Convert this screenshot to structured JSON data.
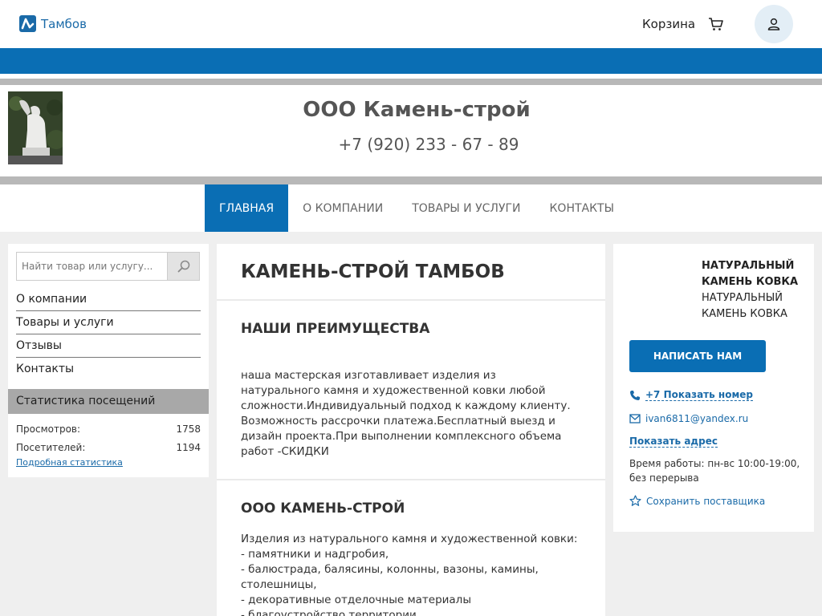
{
  "topbar": {
    "city": "Тамбов",
    "cart_label": "Корзина"
  },
  "header": {
    "company_name": "ООО Камень-строй",
    "phone": "+7 (920) 233 - 67 - 89"
  },
  "nav": {
    "items": [
      {
        "label": "Главная",
        "active": true
      },
      {
        "label": "О компании"
      },
      {
        "label": "Товары и услуги"
      },
      {
        "label": "Контакты"
      }
    ]
  },
  "sidebar": {
    "search_placeholder": "Найти товар или услугу...",
    "menu": [
      "О компании",
      "Товары и услуги",
      "Отзывы",
      "Контакты"
    ],
    "stats": {
      "header": "Статистика посещений",
      "views_label": "Просмотров:",
      "views_value": "1758",
      "visitors_label": "Посетителей:",
      "visitors_value": "1194",
      "link": "Подробная статистика"
    }
  },
  "main": {
    "title": "КАМЕНЬ-СТРОЙ ТАМБОВ",
    "sections": [
      {
        "title": "НАШИ ПРЕИМУЩЕСТВА",
        "text": "наша мастерская изготавливает изделия из натурального камня и художественной ковки любой сложности.Индивидуальный подход к каждому клиенту. Возможность рассрочки платежа.Бесплатный выезд и дизайн проекта.При выполнении комплексного объема работ -СКИДКИ"
      },
      {
        "title": "ООО КАМЕНЬ-СТРОЙ",
        "text": "Изделия из натурального камня и художественной ковки:\n- памятники и надгробия,\n- балюстрада, балясины, колонны, вазоны, камины, столешницы,\n- декоративные отделочные материалы\n- благоустройство территории"
      }
    ]
  },
  "right": {
    "tags_bold": "НАТУРАЛЬНЫЙ КАМЕНЬ КОВКА",
    "tags": "НАТУРАЛЬНЫЙ КАМЕНЬ КОВКА",
    "write_button": "НАПИСАТЬ НАМ",
    "show_phone": "+7 Показать номер",
    "email": "ivan6811@yandex.ru",
    "show_address": "Показать адрес",
    "hours": "Время работы: пн-вс 10:00-19:00, без перерыва",
    "save_supplier": "Сохранить поставщика"
  },
  "colors": {
    "brand_blue": "#0a6eb4",
    "link_blue": "#1a6aa8",
    "band_grey": "#b8b8b8",
    "page_bg": "#efefef"
  }
}
